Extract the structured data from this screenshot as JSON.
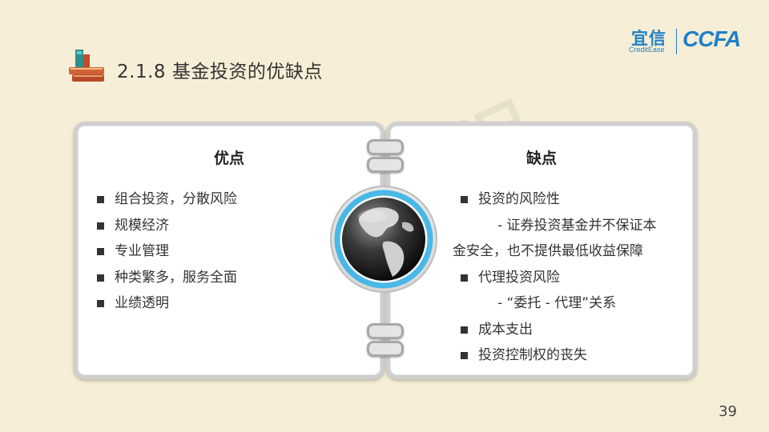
{
  "title": "2.1.8 基金投资的优缺点",
  "logo": {
    "cn": "宜信",
    "en": "CreditEase",
    "ccfa": "CCFA"
  },
  "left_panel": {
    "heading": "优点",
    "items": [
      "组合投资，分散风险",
      "规模经济",
      "专业管理",
      "种类繁多，服务全面",
      "业绩透明"
    ]
  },
  "right_panel": {
    "heading": "缺点",
    "items": [
      {
        "text": "投资的风险性",
        "kind": "bullet"
      },
      {
        "text": "- 证券投资基金并不保证本",
        "kind": "sub"
      },
      {
        "text": "金安全，也不提供最低收益保障",
        "kind": "cont"
      },
      {
        "text": "代理投资风险",
        "kind": "bullet"
      },
      {
        "text": "- “委托 - 代理”关系",
        "kind": "sub"
      },
      {
        "text": "成本支出",
        "kind": "bullet"
      },
      {
        "text": "投资控制权的丧失",
        "kind": "bullet"
      }
    ]
  },
  "page_number": "39",
  "colors": {
    "accent": "#1f80c8",
    "background": "#f6eed6",
    "globe_ring": "#49b8e6"
  }
}
